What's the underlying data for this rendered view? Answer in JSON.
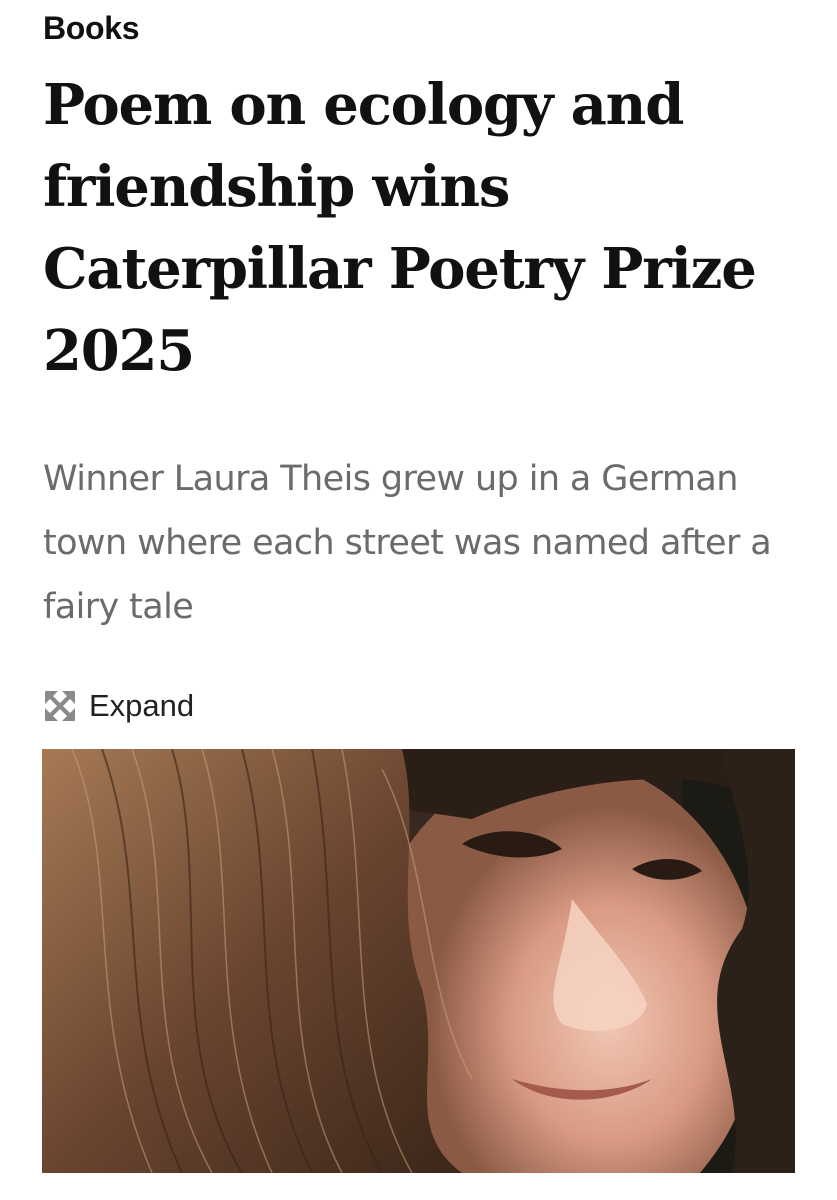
{
  "section": {
    "label": "Books"
  },
  "article": {
    "headline": "Poem on ecology and friendship wins Caterpillar Poetry Prize 2025",
    "standfirst": "Winner Laura Theis grew up in a German town where each street was named after a fairy tale",
    "expand_label": "Expand",
    "expand_icon": "expand-arrows-icon"
  },
  "image": {
    "subject": "portrait-photo"
  },
  "colors": {
    "text": "#111111",
    "standfirst": "#6b6b6b",
    "icon": "#8a8a8a"
  }
}
